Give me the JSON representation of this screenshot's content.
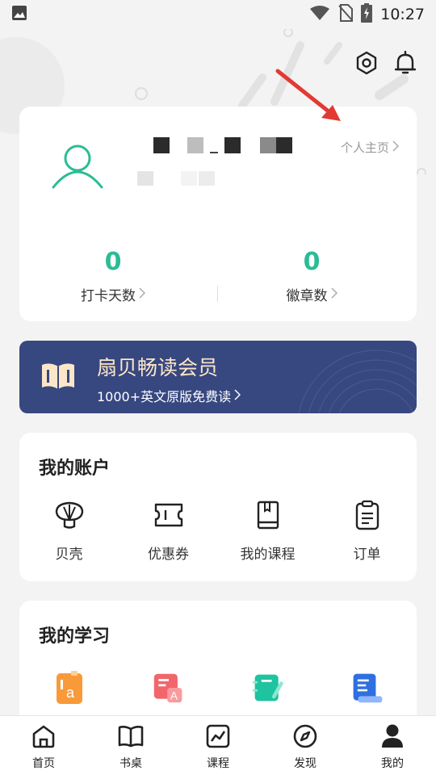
{
  "status_bar": {
    "time": "10:27"
  },
  "header": {
    "icons": [
      "settings-hexagon-icon",
      "bell-icon"
    ]
  },
  "profile": {
    "home_link_label": "个人主页",
    "stats": [
      {
        "value": "0",
        "label": "打卡天数"
      },
      {
        "value": "0",
        "label": "徽章数"
      }
    ]
  },
  "vip": {
    "title": "扇贝畅读会员",
    "subtitle": "1000+英文原版免费读"
  },
  "account": {
    "title": "我的账户",
    "items": [
      {
        "label": "贝壳",
        "icon": "shell-icon"
      },
      {
        "label": "优惠券",
        "icon": "coupon-icon"
      },
      {
        "label": "我的课程",
        "icon": "course-book-icon"
      },
      {
        "label": "订单",
        "icon": "order-clipboard-icon"
      }
    ]
  },
  "study": {
    "title": "我的学习",
    "items": [
      {
        "icon": "vocabulary-icon"
      },
      {
        "icon": "word-book-icon"
      },
      {
        "icon": "notebook-icon"
      },
      {
        "icon": "document-icon"
      }
    ]
  },
  "bottom_nav": [
    {
      "label": "首页",
      "icon": "home-icon"
    },
    {
      "label": "书桌",
      "icon": "book-open-icon"
    },
    {
      "label": "课程",
      "icon": "chart-icon"
    },
    {
      "label": "发现",
      "icon": "compass-icon"
    },
    {
      "label": "我的",
      "icon": "person-icon"
    }
  ],
  "colors": {
    "accent": "#2bbc95",
    "vip_bg": "#374780",
    "vip_title": "#fbe7c8"
  }
}
